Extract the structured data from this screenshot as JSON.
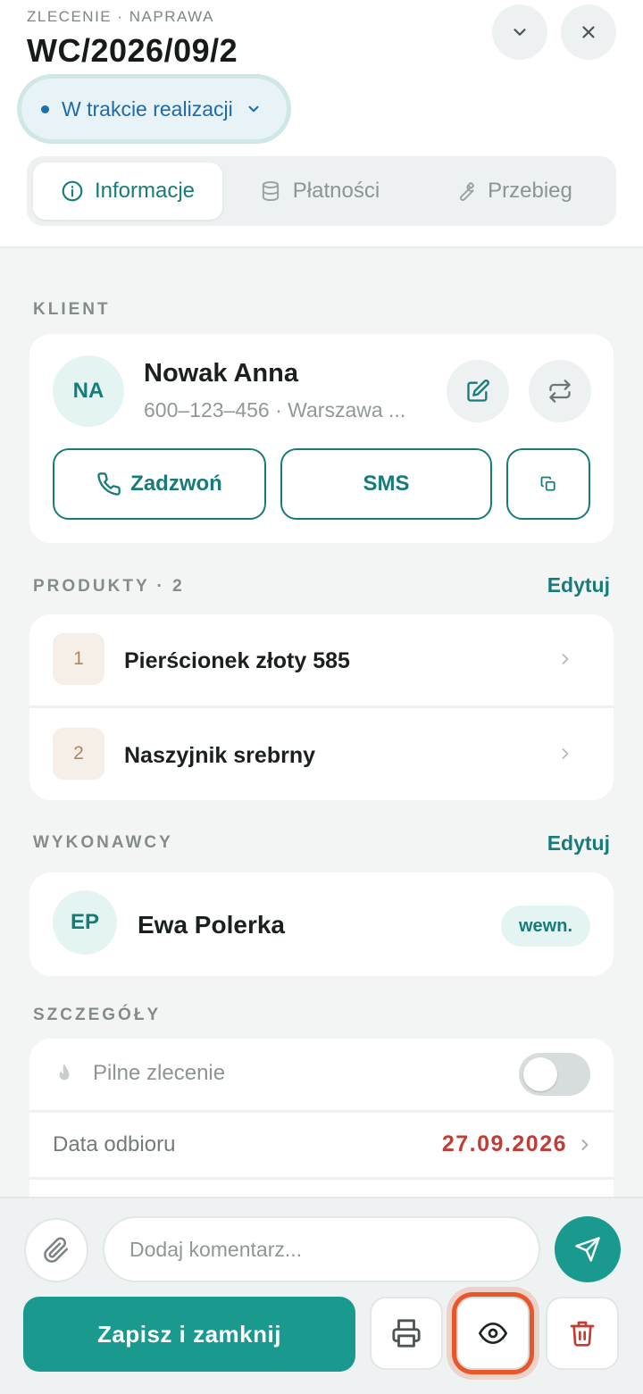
{
  "header": {
    "kicker": "ZLECENIE · NAPRAWA",
    "order_number": "WC/2026/09/2",
    "status": "W trakcie realizacji",
    "tabs": [
      {
        "label": "Informacje",
        "icon": "info-icon",
        "active": true
      },
      {
        "label": "Płatności",
        "icon": "database-icon",
        "active": false
      },
      {
        "label": "Przebieg",
        "icon": "wrench-icon",
        "active": false
      }
    ]
  },
  "client": {
    "section_label": "KLIENT",
    "initials": "NA",
    "name": "Nowak Anna",
    "subtitle": "600–123–456 · Warszawa ...",
    "call_label": "Zadzwoń",
    "sms_label": "SMS"
  },
  "products": {
    "section_label": "PRODUKTY · 2",
    "edit_label": "Edytuj",
    "items": [
      {
        "number": "1",
        "name": "Pierścionek złoty 585"
      },
      {
        "number": "2",
        "name": "Naszyjnik srebrny"
      }
    ]
  },
  "contractors": {
    "section_label": "WYKONAWCY",
    "edit_label": "Edytuj",
    "initials": "EP",
    "name": "Ewa Polerka",
    "badge": "wewn."
  },
  "details": {
    "section_label": "SZCZEGÓŁY",
    "urgent_label": "Pilne zlecenie",
    "urgent_on": false,
    "pickup_label": "Data odbioru",
    "pickup_value": "27.09.2026"
  },
  "footer": {
    "comment_placeholder": "Dodaj komentarz...",
    "save_label": "Zapisz i zamknij"
  },
  "colors": {
    "accent": "#1a9a8e",
    "accent_dark": "#177c79",
    "status_blue": "#1f6aa6",
    "danger": "#c23b35",
    "highlight": "#e8562a"
  }
}
